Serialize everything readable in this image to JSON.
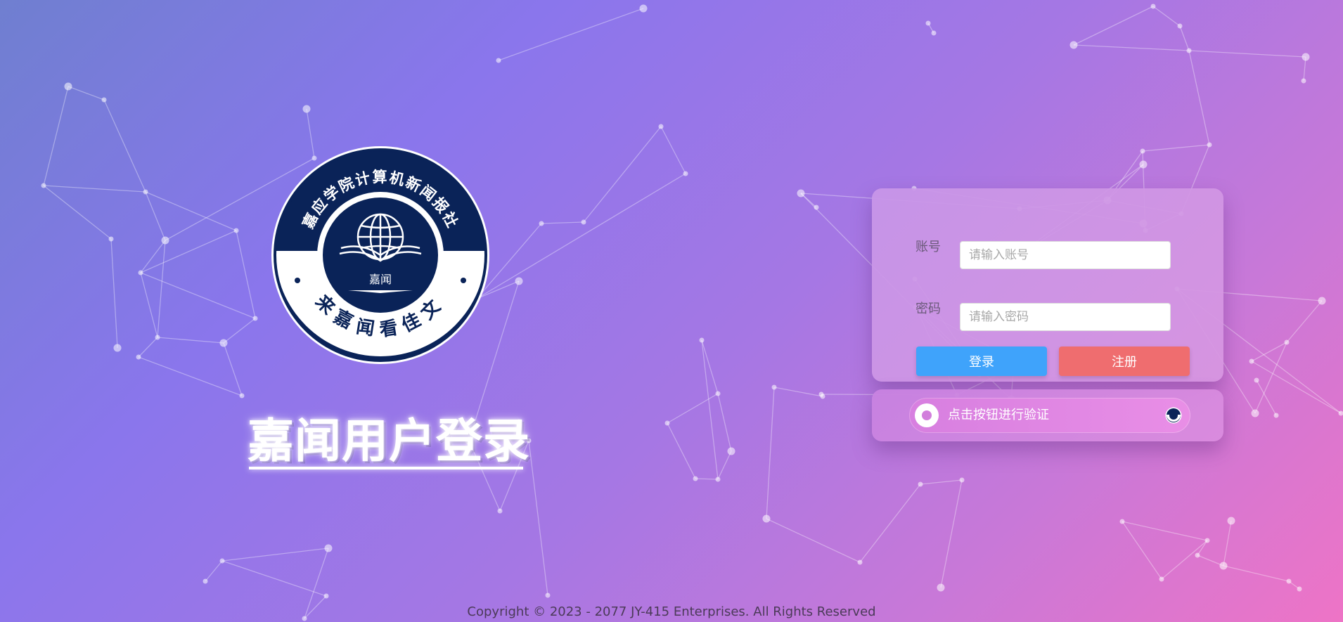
{
  "background": {
    "gradient_colors": [
      "#6f7fd0",
      "#8a76ec",
      "#a577e4",
      "#c878d8",
      "#ee74c6"
    ]
  },
  "logo": {
    "ring_text_top": "嘉应学院计算机新闻报社",
    "ring_text_bottom": "来嘉闻看佳文",
    "center_text": "嘉闻",
    "colors": {
      "navy": "#0a2358",
      "white": "#ffffff"
    }
  },
  "page_title": "嘉闻用户登录",
  "login_form": {
    "account_label": "账号",
    "account_placeholder": "请输入账号",
    "account_value": "",
    "password_label": "密码",
    "password_placeholder": "请输入密码",
    "password_value": "",
    "login_button": "登录",
    "register_button": "注册",
    "colors": {
      "login": "#3fa3fb",
      "register": "#ef6d6f"
    }
  },
  "verify": {
    "label": "点击按钮进行验证"
  },
  "footer": {
    "copyright": "Copyright © 2023 - 2077 JY-415 Enterprises. All Rights Reserved"
  }
}
